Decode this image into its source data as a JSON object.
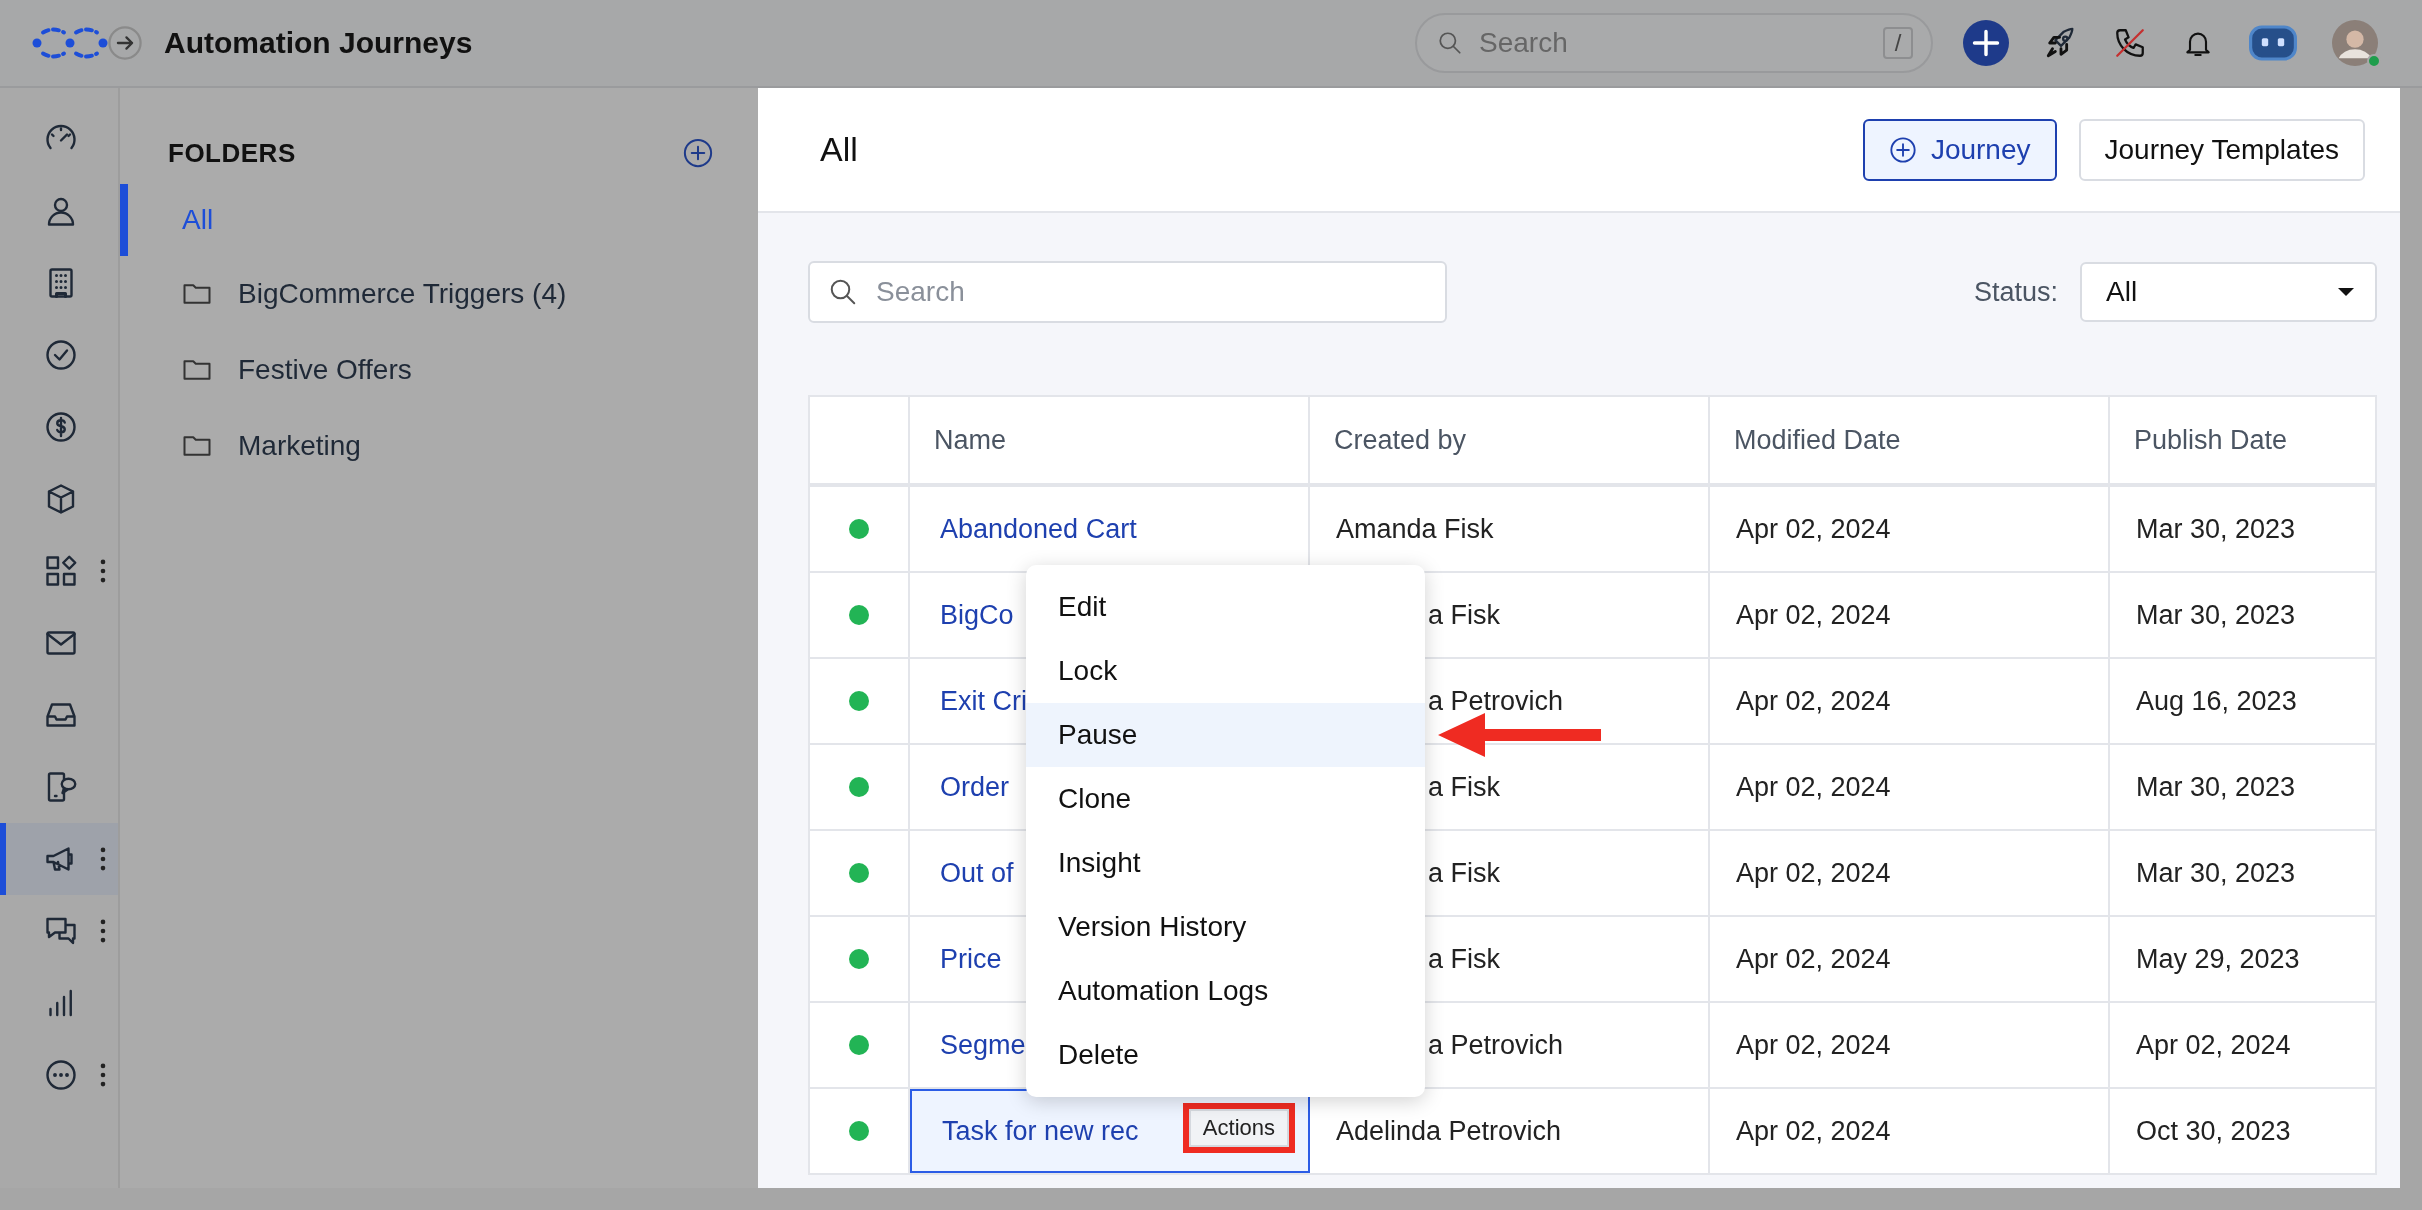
{
  "app": {
    "title": "Automation Journeys"
  },
  "top_search": {
    "placeholder": "Search",
    "shortcut": "/"
  },
  "nav_items": [
    {
      "selected": false,
      "has_menu": false
    },
    {
      "selected": false,
      "has_menu": false
    },
    {
      "selected": false,
      "has_menu": false
    },
    {
      "selected": false,
      "has_menu": false
    },
    {
      "selected": false,
      "has_menu": false
    },
    {
      "selected": false,
      "has_menu": false
    },
    {
      "selected": false,
      "has_menu": true
    },
    {
      "selected": false,
      "has_menu": false
    },
    {
      "selected": false,
      "has_menu": false
    },
    {
      "selected": false,
      "has_menu": false
    },
    {
      "selected": true,
      "has_menu": true
    },
    {
      "selected": false,
      "has_menu": true
    },
    {
      "selected": false,
      "has_menu": false
    },
    {
      "selected": false,
      "has_menu": true
    }
  ],
  "folders": {
    "title": "FOLDERS",
    "items": [
      {
        "kind": "all",
        "label": "All",
        "selected": true
      },
      {
        "kind": "folder",
        "label": "BigCommerce Triggers (4)",
        "selected": false
      },
      {
        "kind": "folder",
        "label": "Festive Offers",
        "selected": false
      },
      {
        "kind": "folder",
        "label": "Marketing",
        "selected": false
      }
    ]
  },
  "main": {
    "title": "All",
    "buttons": [
      {
        "kind": "primary",
        "label": "Journey"
      },
      {
        "kind": "secondary",
        "label": "Journey Templates"
      }
    ]
  },
  "filter": {
    "search_placeholder": "Search",
    "status_label": "Status:",
    "status_value": "All"
  },
  "table": {
    "columns": [
      "Name",
      "Created by",
      "Modified Date",
      "Publish Date"
    ],
    "rows": [
      {
        "color": "#22b455",
        "name": "Abandoned Cart",
        "created_by": "Amanda Fisk",
        "modified": "Apr 02, 2024",
        "published": "Mar 30, 2023",
        "selected": false
      },
      {
        "color": "#22b455",
        "name": "BigCo",
        "created_by": "a Fisk",
        "modified": "Apr 02, 2024",
        "published": "Mar 30, 2023",
        "selected": false
      },
      {
        "color": "#22b455",
        "name": "Exit Cri",
        "created_by": "a Petrovich",
        "modified": "Apr 02, 2024",
        "published": "Aug 16, 2023",
        "selected": false
      },
      {
        "color": "#22b455",
        "name": "Order",
        "created_by": "a Fisk",
        "modified": "Apr 02, 2024",
        "published": "Mar 30, 2023",
        "selected": false
      },
      {
        "color": "#22b455",
        "name": "Out of",
        "created_by": "a Fisk",
        "modified": "Apr 02, 2024",
        "published": "Mar 30, 2023",
        "selected": false
      },
      {
        "color": "#22b455",
        "name": "Price",
        "created_by": "a Fisk",
        "modified": "Apr 02, 2024",
        "published": "May 29, 2023",
        "selected": false
      },
      {
        "color": "#22b455",
        "name": "Segme",
        "created_by": "a Petrovich",
        "modified": "Apr 02, 2024",
        "published": "Apr 02, 2024",
        "selected": false
      },
      {
        "color": "#22b455",
        "name": "Task for new rec",
        "created_by": "Adelinda Petrovich",
        "modified": "Apr 02, 2024",
        "published": "Oct 30, 2023",
        "selected": true,
        "action": "Actions"
      }
    ]
  },
  "menu": {
    "items": [
      {
        "label": "Edit",
        "selected": false
      },
      {
        "label": "Lock",
        "selected": false
      },
      {
        "label": "Pause",
        "selected": true
      },
      {
        "label": "Clone",
        "selected": false
      },
      {
        "label": "Insight",
        "selected": false
      },
      {
        "label": "Version History",
        "selected": false
      },
      {
        "label": "Automation Logs",
        "selected": false
      },
      {
        "label": "Delete",
        "selected": false
      }
    ]
  }
}
